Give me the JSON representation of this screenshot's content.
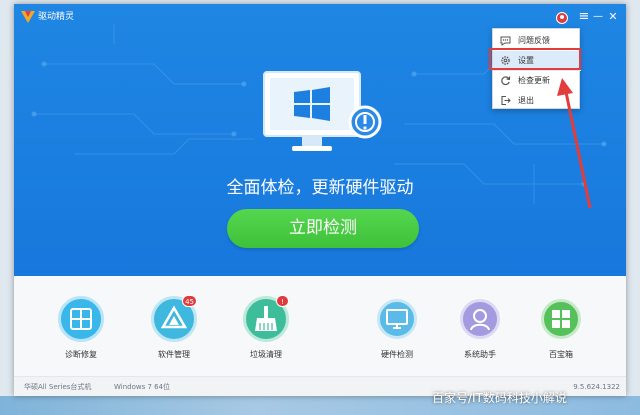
{
  "app": {
    "name": "驱动精灵"
  },
  "titlebar": {
    "menu_icon": "≡",
    "minimize_icon": "—",
    "close_icon": "✕"
  },
  "menu": {
    "items": [
      {
        "label": "问题反馈",
        "icon": "feedback-icon"
      },
      {
        "label": "设置",
        "icon": "gear-icon"
      },
      {
        "label": "检查更新",
        "icon": "refresh-icon"
      },
      {
        "label": "退出",
        "icon": "exit-icon"
      }
    ]
  },
  "hero": {
    "slogan": "全面体检，更新硬件驱动",
    "scan_button": "立即检测"
  },
  "tools": [
    {
      "label": "诊断修复",
      "icon": "repair-icon",
      "color": "#39b6ea"
    },
    {
      "label": "软件管理",
      "icon": "software-icon",
      "color": "#3fb8e0",
      "badge": "45"
    },
    {
      "label": "垃圾清理",
      "icon": "broom-icon",
      "color": "#3ebd9a",
      "badge": "!"
    },
    {
      "label": "硬件检测",
      "icon": "hardware-icon",
      "color": "#5bbbe8"
    },
    {
      "label": "系统助手",
      "icon": "assistant-icon",
      "color": "#a49ae0"
    },
    {
      "label": "百宝箱",
      "icon": "toolbox-icon",
      "color": "#56c05a"
    }
  ],
  "status": {
    "device": "华硕All Series台式机",
    "os": "Windows 7 64位",
    "version": "9.5.624.1322"
  },
  "watermark": "百家号/IT数码科技小解说",
  "colors": {
    "hero_blue": "#1a7ee0",
    "scan_green": "#3ec23a",
    "highlight_red": "#e43b3b"
  }
}
